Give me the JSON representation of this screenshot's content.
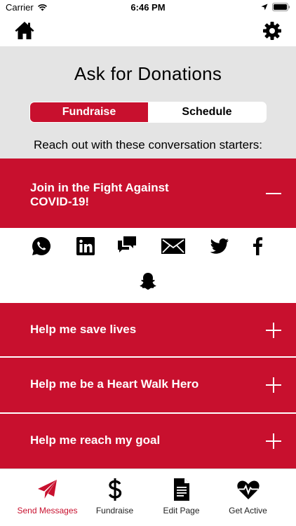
{
  "status_bar": {
    "carrier": "Carrier",
    "time": "6:46 PM"
  },
  "header": {
    "title": "Ask for Donations"
  },
  "segments": {
    "left": "Fundraise",
    "right": "Schedule",
    "active": "Fundraise"
  },
  "subtitle": "Reach out with these conversation starters:",
  "accordion": [
    {
      "title": "Join in the Fight Against COVID-19!",
      "expanded": true
    },
    {
      "title": "Help me save lives",
      "expanded": false
    },
    {
      "title": "Help me be a Heart Walk Hero",
      "expanded": false
    },
    {
      "title": "Help me reach my goal",
      "expanded": false
    }
  ],
  "share_icons": [
    "whatsapp-icon",
    "linkedin-icon",
    "chat-bubbles-icon",
    "email-icon",
    "twitter-icon",
    "facebook-icon",
    "snapchat-icon"
  ],
  "tabs": [
    {
      "label": "Send Messages",
      "icon": "paper-plane-icon",
      "active": true
    },
    {
      "label": "Fundraise",
      "icon": "dollar-icon",
      "active": false
    },
    {
      "label": "Edit Page",
      "icon": "document-icon",
      "active": false
    },
    {
      "label": "Get Active",
      "icon": "heart-pulse-icon",
      "active": false
    }
  ],
  "colors": {
    "brand_red": "#c8102e",
    "header_gray": "#e4e4e4"
  }
}
